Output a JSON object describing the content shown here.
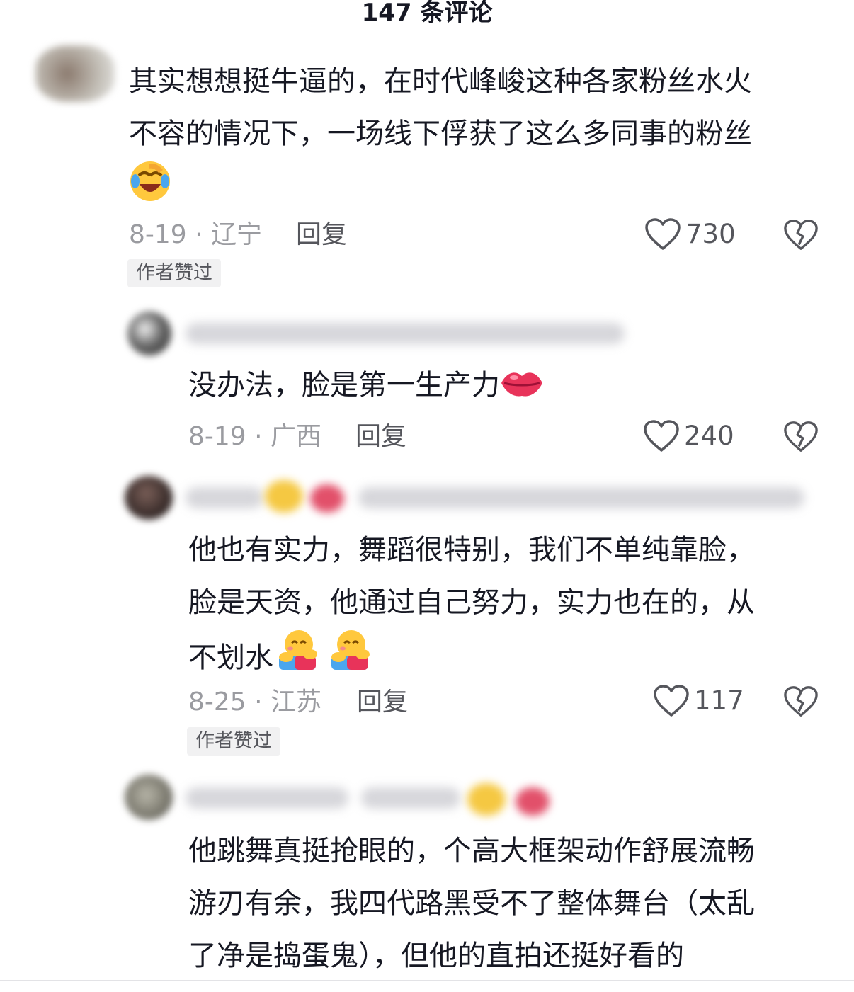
{
  "header": {
    "title": "147 条评论"
  },
  "colors": {
    "text": "#161823",
    "meta": "#9a9ba0",
    "action": "#55565c",
    "badge_bg": "#f1f1f2"
  },
  "comments": [
    {
      "text_lines": [
        "其实想想挺牛逼的，在时代峰峻这种各家粉丝水火",
        "不容的情况下，一场线下俘获了这么多同事的粉丝"
      ],
      "emojis": [
        "laughing-crying-emoji"
      ],
      "date_location": "8-19 · 辽宁",
      "reply_label": "回复",
      "likes": "730",
      "badge": "作者赞过"
    },
    {
      "text_lines": [
        "没办法，脸是第一生产力"
      ],
      "emojis": [
        "lips-emoji"
      ],
      "date_location": "8-19 · 广西",
      "reply_label": "回复",
      "likes": "240"
    },
    {
      "text_lines": [
        "他也有实力，舞蹈很特别，我们不单纯靠脸，",
        "脸是天资，他通过自己努力，实力也在的，从",
        "不划水"
      ],
      "emojis": [
        "hug-emoji",
        "hug-emoji"
      ],
      "date_location": "8-25 · 江苏",
      "reply_label": "回复",
      "likes": "117",
      "badge": "作者赞过"
    },
    {
      "text_lines": [
        "他跳舞真挺抢眼的，个高大框架动作舒展流畅",
        "游刃有余，我四代路黑受不了整体舞台（太乱",
        "了净是捣蛋鬼），但他的直拍还挺好看的"
      ]
    }
  ]
}
